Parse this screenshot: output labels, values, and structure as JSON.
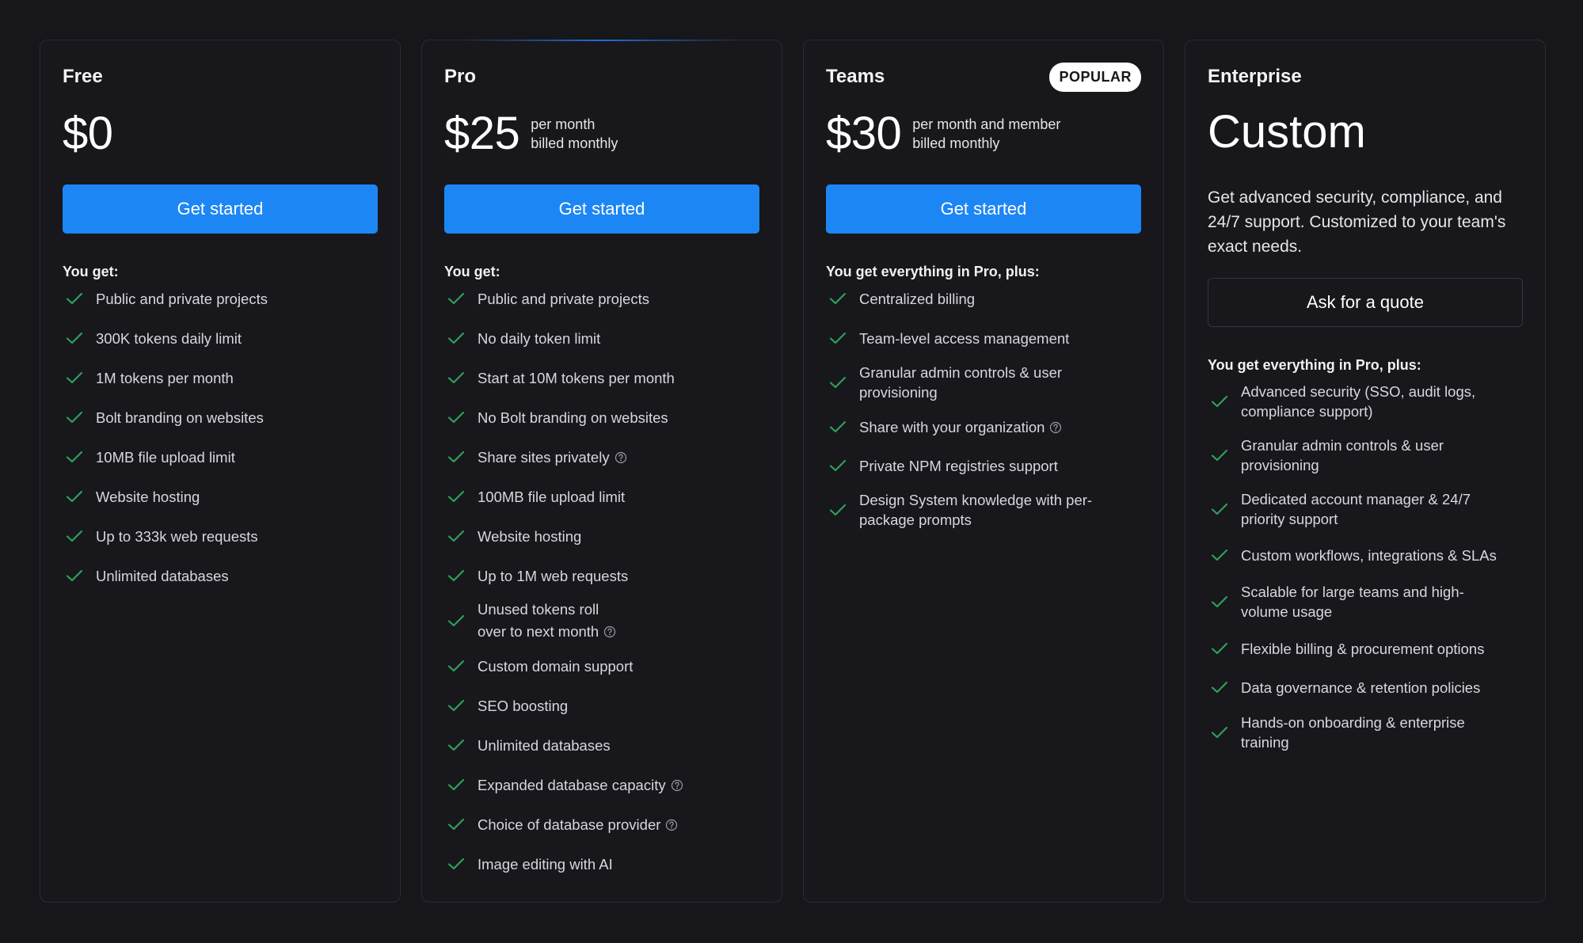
{
  "accent": "#1d86f5",
  "check_color": "#2fa05a",
  "plans": [
    {
      "name": "Free",
      "price": "$0",
      "cta": "Get started",
      "list_title": "You get:",
      "features": [
        "Public and private projects",
        "300K tokens daily limit",
        "1M tokens per month",
        "Bolt branding on websites",
        "10MB file upload limit",
        "Website hosting",
        "Up to 333k web requests",
        "Unlimited databases"
      ]
    },
    {
      "name": "Pro",
      "price": "$25",
      "price_note_1": "per month",
      "price_note_2": "billed monthly",
      "cta": "Get started",
      "list_title": "You get:",
      "features": [
        "Public and private projects",
        "No daily token limit",
        "Start at 10M tokens per month",
        "No Bolt branding on websites",
        "Share sites privately",
        "100MB file upload limit",
        "Website hosting",
        "Up to 1M web requests",
        "Unused tokens roll",
        "over to next month",
        "Custom domain support",
        "SEO boosting",
        "Unlimited databases",
        "Expanded database capacity",
        "Choice of database provider",
        "Image editing with AI"
      ]
    },
    {
      "name": "Teams",
      "badge": "POPULAR",
      "price": "$30",
      "price_note_1": "per month and member",
      "price_note_2": "billed monthly",
      "cta": "Get started",
      "list_title": "You get everything in Pro, plus:",
      "features": [
        "Centralized billing",
        "Team-level access management",
        "Granular admin controls & user",
        "provisioning",
        "Share with your organization",
        "Private NPM registries support",
        "Design System knowledge with per-",
        "package prompts"
      ]
    },
    {
      "name": "Enterprise",
      "price": "Custom",
      "description": "Get advanced security, compliance, and 24/7 support. Customized to your team's exact needs.",
      "cta": "Ask for a quote",
      "list_title": "You get everything in Pro, plus:",
      "features": [
        "Advanced security (SSO, audit logs,",
        "compliance support)",
        "Granular admin controls & user",
        "provisioning",
        "Dedicated account manager & 24/7",
        "priority support",
        "Custom workflows, integrations & SLAs",
        "Scalable for large teams and high-",
        "volume usage",
        "Flexible billing & procurement options",
        "Data governance & retention policies",
        "Hands-on onboarding & enterprise",
        "training"
      ]
    }
  ]
}
